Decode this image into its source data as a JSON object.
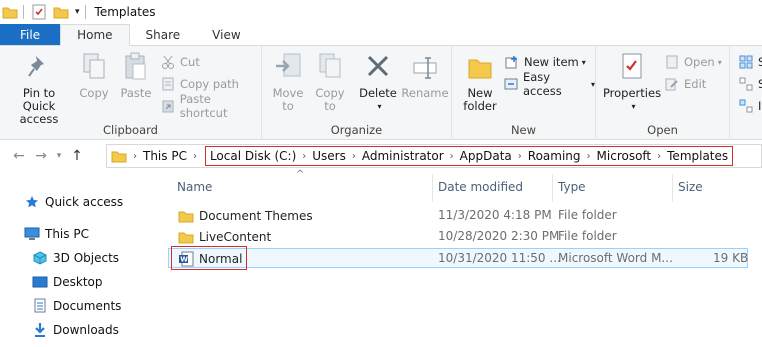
{
  "window": {
    "title": "Templates"
  },
  "ribbon": {
    "tabs": [
      {
        "label": "File"
      },
      {
        "label": "Home"
      },
      {
        "label": "Share"
      },
      {
        "label": "View"
      }
    ],
    "clipboard": {
      "label": "Clipboard",
      "pin_label_1": "Pin to Quick",
      "pin_label_2": "access",
      "copy": "Copy",
      "paste": "Paste",
      "cut": "Cut",
      "copy_path": "Copy path",
      "paste_shortcut": "Paste shortcut"
    },
    "organize": {
      "label": "Organize",
      "move_1": "Move",
      "move_2": "to",
      "copyto_1": "Copy",
      "copyto_2": "to",
      "delete": "Delete",
      "rename": "Rename"
    },
    "new": {
      "label": "New",
      "newfolder_1": "New",
      "newfolder_2": "folder",
      "new_item": "New item",
      "easy_access": "Easy access"
    },
    "open": {
      "label": "Open",
      "properties": "Properties",
      "open": "Open",
      "edit": "Edit"
    },
    "select": {
      "s1": "S",
      "s2": "S",
      "s3": "I"
    }
  },
  "address": {
    "crumbs": [
      "This PC",
      "Local Disk (C:)",
      "Users",
      "Administrator",
      "AppData",
      "Roaming",
      "Microsoft",
      "Templates"
    ]
  },
  "nav": {
    "items": [
      {
        "label": "Quick access",
        "icon": "star-icon"
      },
      {
        "label": "This PC",
        "icon": "computer-icon"
      },
      {
        "label": "3D Objects",
        "icon": "cube-icon"
      },
      {
        "label": "Desktop",
        "icon": "desktop-icon"
      },
      {
        "label": "Documents",
        "icon": "documents-icon"
      },
      {
        "label": "Downloads",
        "icon": "download-icon"
      }
    ]
  },
  "files": {
    "columns": {
      "name": "Name",
      "date": "Date modified",
      "type": "Type",
      "size": "Size"
    },
    "rows": [
      {
        "name": "Document Themes",
        "date": "11/3/2020 4:18 PM",
        "type": "File folder",
        "size": "",
        "icon": "folder-icon"
      },
      {
        "name": "LiveContent",
        "date": "10/28/2020 2:30 PM",
        "type": "File folder",
        "size": "",
        "icon": "folder-icon"
      },
      {
        "name": "Normal",
        "date": "10/31/2020 11:50 ...",
        "type": "Microsoft Word M...",
        "size": "19 KB",
        "icon": "word-file-icon"
      }
    ]
  },
  "colors": {
    "file_tab": "#1a6fc4",
    "highlight_box": "#d0302c",
    "folder": "#f4c84a",
    "selection": "#99d1ff"
  }
}
